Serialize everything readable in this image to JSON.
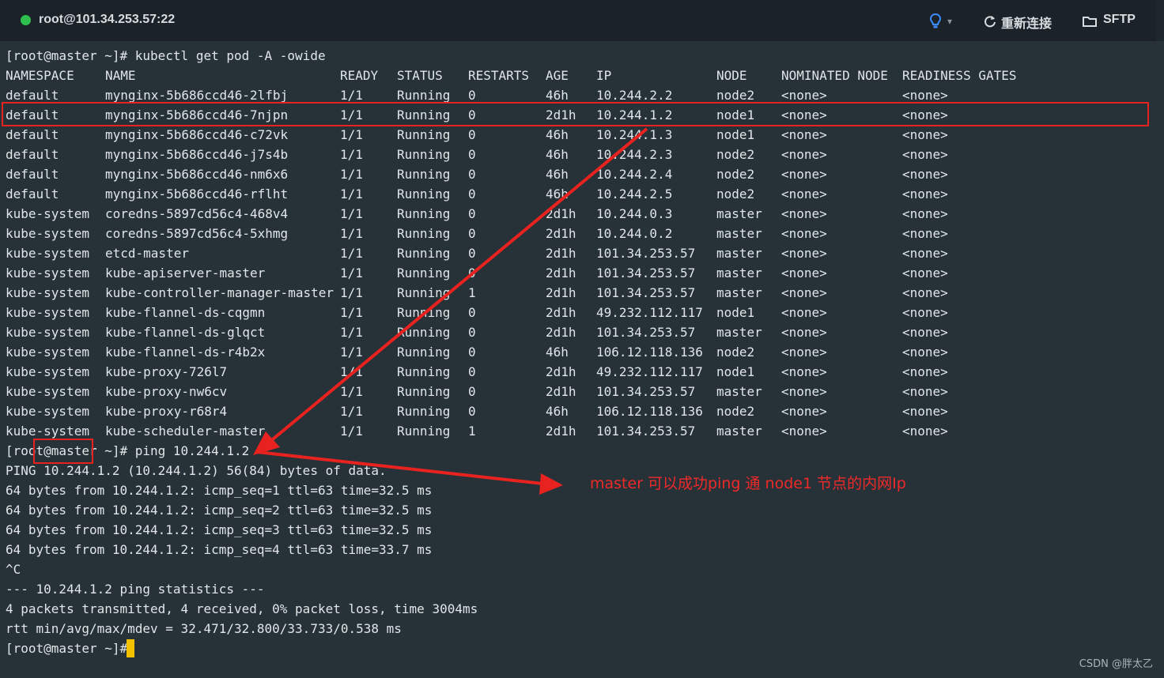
{
  "window": {
    "host": "root@101.34.253.57:22",
    "reconnect_label": "重新连接",
    "sftp_label": "SFTP",
    "connected_color": "#2fbf4d",
    "bulb_color": "#3d8bfd"
  },
  "terminal": {
    "command_prompt": "[root@master ~]# kubectl get pod -A -owide",
    "headers": [
      "NAMESPACE",
      "NAME",
      "READY",
      "STATUS",
      "RESTARTS",
      "AGE",
      "IP",
      "NODE",
      "NOMINATED NODE",
      "READINESS GATES"
    ],
    "rows": [
      [
        "default",
        "mynginx-5b686ccd46-2lfbj",
        "1/1",
        "Running",
        "0",
        "46h",
        "10.244.2.2",
        "node2",
        "<none>",
        "<none>"
      ],
      [
        "default",
        "mynginx-5b686ccd46-7njpn",
        "1/1",
        "Running",
        "0",
        "2d1h",
        "10.244.1.2",
        "node1",
        "<none>",
        "<none>"
      ],
      [
        "default",
        "mynginx-5b686ccd46-c72vk",
        "1/1",
        "Running",
        "0",
        "46h",
        "10.244.1.3",
        "node1",
        "<none>",
        "<none>"
      ],
      [
        "default",
        "mynginx-5b686ccd46-j7s4b",
        "1/1",
        "Running",
        "0",
        "46h",
        "10.244.2.3",
        "node2",
        "<none>",
        "<none>"
      ],
      [
        "default",
        "mynginx-5b686ccd46-nm6x6",
        "1/1",
        "Running",
        "0",
        "46h",
        "10.244.2.4",
        "node2",
        "<none>",
        "<none>"
      ],
      [
        "default",
        "mynginx-5b686ccd46-rflht",
        "1/1",
        "Running",
        "0",
        "46h",
        "10.244.2.5",
        "node2",
        "<none>",
        "<none>"
      ],
      [
        "kube-system",
        "coredns-5897cd56c4-468v4",
        "1/1",
        "Running",
        "0",
        "2d1h",
        "10.244.0.3",
        "master",
        "<none>",
        "<none>"
      ],
      [
        "kube-system",
        "coredns-5897cd56c4-5xhmg",
        "1/1",
        "Running",
        "0",
        "2d1h",
        "10.244.0.2",
        "master",
        "<none>",
        "<none>"
      ],
      [
        "kube-system",
        "etcd-master",
        "1/1",
        "Running",
        "0",
        "2d1h",
        "101.34.253.57",
        "master",
        "<none>",
        "<none>"
      ],
      [
        "kube-system",
        "kube-apiserver-master",
        "1/1",
        "Running",
        "0",
        "2d1h",
        "101.34.253.57",
        "master",
        "<none>",
        "<none>"
      ],
      [
        "kube-system",
        "kube-controller-manager-master",
        "1/1",
        "Running",
        "1",
        "2d1h",
        "101.34.253.57",
        "master",
        "<none>",
        "<none>"
      ],
      [
        "kube-system",
        "kube-flannel-ds-cqgmn",
        "1/1",
        "Running",
        "0",
        "2d1h",
        "49.232.112.117",
        "node1",
        "<none>",
        "<none>"
      ],
      [
        "kube-system",
        "kube-flannel-ds-glqct",
        "1/1",
        "Running",
        "0",
        "2d1h",
        "101.34.253.57",
        "master",
        "<none>",
        "<none>"
      ],
      [
        "kube-system",
        "kube-flannel-ds-r4b2x",
        "1/1",
        "Running",
        "0",
        "46h",
        "106.12.118.136",
        "node2",
        "<none>",
        "<none>"
      ],
      [
        "kube-system",
        "kube-proxy-726l7",
        "1/1",
        "Running",
        "0",
        "2d1h",
        "49.232.112.117",
        "node1",
        "<none>",
        "<none>"
      ],
      [
        "kube-system",
        "kube-proxy-nw6cv",
        "1/1",
        "Running",
        "0",
        "2d1h",
        "101.34.253.57",
        "master",
        "<none>",
        "<none>"
      ],
      [
        "kube-system",
        "kube-proxy-r68r4",
        "1/1",
        "Running",
        "0",
        "46h",
        "106.12.118.136",
        "node2",
        "<none>",
        "<none>"
      ],
      [
        "kube-system",
        "kube-scheduler-master",
        "1/1",
        "Running",
        "1",
        "2d1h",
        "101.34.253.57",
        "master",
        "<none>",
        "<none>"
      ]
    ],
    "highlighted_row": 1,
    "output_lines": [
      "[root@master ~]# ping 10.244.1.2",
      "PING 10.244.1.2 (10.244.1.2) 56(84) bytes of data.",
      "64 bytes from 10.244.1.2: icmp_seq=1 ttl=63 time=32.5 ms",
      "64 bytes from 10.244.1.2: icmp_seq=2 ttl=63 time=32.5 ms",
      "64 bytes from 10.244.1.2: icmp_seq=3 ttl=63 time=32.5 ms",
      "64 bytes from 10.244.1.2: icmp_seq=4 ttl=63 time=33.7 ms",
      "^C",
      "--- 10.244.1.2 ping statistics ---",
      "4 packets transmitted, 4 received, 0% packet loss, time 3004ms",
      "rtt min/avg/max/mdev = 32.471/32.800/33.733/0.538 ms",
      "[root@master ~]#"
    ],
    "cursor_color": "#f2c200"
  },
  "annotation": {
    "text": "master 可以成功ping 通 node1 节点的内网Ip",
    "color": "#ef2929"
  },
  "footer": {
    "watermark": "CSDN @胖太乙"
  }
}
